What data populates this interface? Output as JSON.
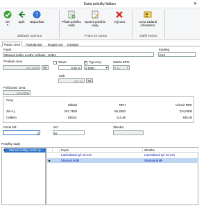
{
  "window": {
    "title": "Karta položky faktury",
    "close": "✕"
  },
  "ribbon": {
    "ok": "OK",
    "back": "Zpět",
    "help": "Nápověda",
    "basic_group": "Základní operace",
    "add_item": "Přidat položku sady",
    "update_item": "Opravit položku sady",
    "remove": "Vyjmout",
    "set_group": "Práce se sadou",
    "price_user": "Cena zadaná uživatelem",
    "other_group": "Další funkce"
  },
  "tabs": [
    "Popis, cena",
    "Podrobnosti",
    "Rozpis cen",
    "Intrastat"
  ],
  "form": {
    "popis_label": "Popis:",
    "popis_value": "Stanové kolíky a nahr. tyčkami - SADA",
    "katalog_label": "Katalog:",
    "katalog_value": "K12",
    "prodejni_cena_label": "Prodejní cena",
    "prodejni_cena_value": "324,0000",
    "kc": "Kč",
    "sleva_label": "Sleva:",
    "sleva_value": "0,00 %",
    "typ_ceny_label": "Typ ceny:",
    "typ_ceny_value": "S DPH",
    "sazba_dph_label": "Sazba DPH:",
    "sazba_dph_value": "0 %",
    "zisk_label": "Zisk:",
    "zisk_value": "167,51",
    "zisk_unit": "Kč",
    "porizovaci_cena_label": "Pořizovací cena:",
    "porizovaci_cena_value": "184,0000"
  },
  "prices": {
    "section_label": "Ceny",
    "headers": [
      "Základ",
      "DPH",
      "Včetně DPH"
    ],
    "rows": [
      {
        "label": "Za m.j.",
        "zaklad": "267,7500",
        "dph": "56,2500",
        "vcetne": "324,0000"
      },
      {
        "label": "Celkem",
        "zaklad": "535,51",
        "dph": "112,49",
        "vcetne": "648,00"
      }
    ]
  },
  "qty": {
    "pocet_label": "Počet MJ:",
    "pocet_value": "2",
    "mj_label": "MJ:",
    "mj_value": "ks",
    "zasoba_label": "Zásoba:",
    "zasoba_value": ""
  },
  "set": {
    "title": "Položky sady",
    "tree_item": "Stanové kolíky a nahr. ty...",
    "headers": {
      "popis": "Popis",
      "zkratka": "Zkratka"
    },
    "rows": [
      {
        "popis": "Laminátová tyč 10 mm",
        "zkratka": "Laminátová tyč 10 mm"
      },
      {
        "popis": "Stanový kolík",
        "zkratka": "Stanový kolík"
      }
    ]
  }
}
